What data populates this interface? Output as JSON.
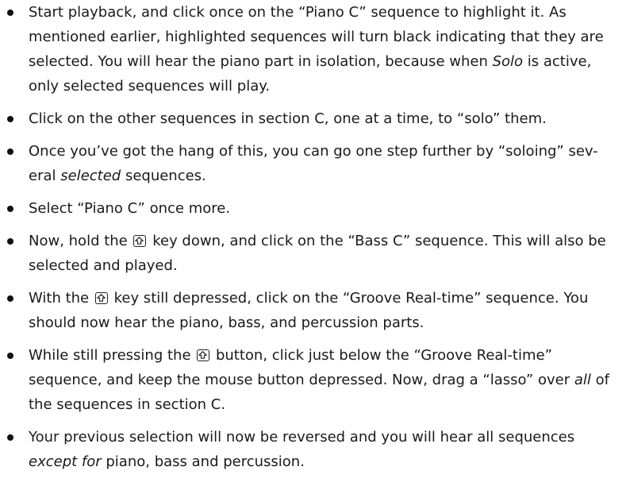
{
  "bullets": [
    {
      "parts": [
        {
          "t": "Start playback, and click once on the “Piano C” sequence to highlight it. As mentioned earlier, highlighted sequences will turn black indicating that they are selected. You will hear the piano part in isolation, because when "
        },
        {
          "t": "Solo",
          "em": true
        },
        {
          "t": " is active, only selected sequences will play."
        }
      ]
    },
    {
      "parts": [
        {
          "t": "Click on the other sequences in section C, one at a time, to “solo” them."
        }
      ]
    },
    {
      "parts": [
        {
          "t": "Once you’ve got the hang of this, you can go one step further by “soloing” sev-eral "
        },
        {
          "t": "selected",
          "em": true
        },
        {
          "t": " sequences."
        }
      ]
    },
    {
      "parts": [
        {
          "t": "Select “Piano C” once more."
        }
      ]
    },
    {
      "parts": [
        {
          "t": "Now, hold the "
        },
        {
          "key": "shift-key-icon"
        },
        {
          "t": " key down, and click on the “Bass C” sequence. This will also be selected and played."
        }
      ]
    },
    {
      "parts": [
        {
          "t": "With the "
        },
        {
          "key": "shift-key-icon"
        },
        {
          "t": " key still depressed, click on the “Groove Real-time” sequence. You should now hear the piano, bass, and percussion parts."
        }
      ]
    },
    {
      "parts": [
        {
          "t": "While still pressing the "
        },
        {
          "key": "shift-key-icon"
        },
        {
          "t": " button, click just below the “Groove Real-time” sequence, and keep the mouse button depressed. Now, drag a “lasso” over "
        },
        {
          "t": "all",
          "em": true
        },
        {
          "t": " of the sequences in section C."
        }
      ]
    },
    {
      "parts": [
        {
          "t": "Your previous selection will now be reversed and you will hear all sequences "
        },
        {
          "t": "except for",
          "em": true
        },
        {
          "t": " piano, bass and percussion."
        }
      ]
    }
  ]
}
